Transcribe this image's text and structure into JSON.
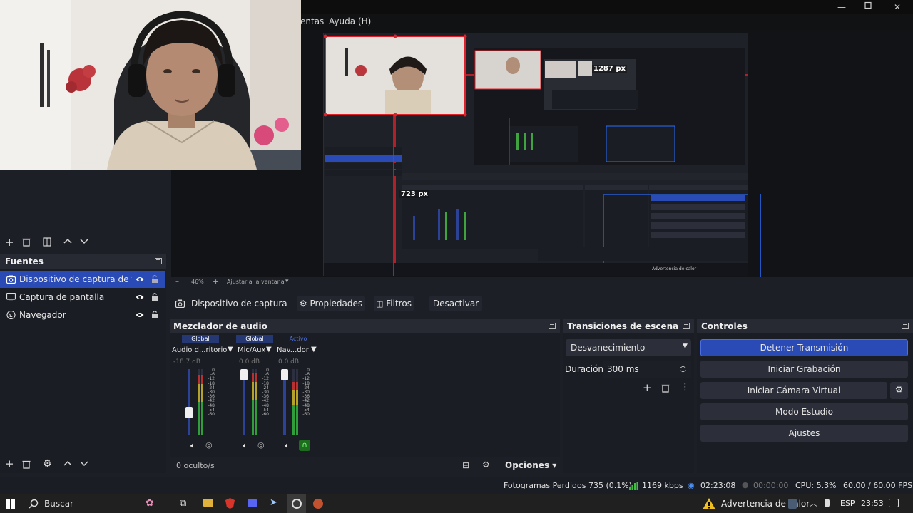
{
  "window": {
    "menu": [
      "entas",
      "Ayuda (H)"
    ],
    "controls": [
      "minimize",
      "maximize",
      "close"
    ]
  },
  "preview": {
    "overlay_width_label": "1287 px",
    "overlay_height_label": "723 px",
    "zoom_label": "46%",
    "fit_label": "Ajustar a la ventana",
    "accent_red": "#e0202a",
    "accent_blue": "#2a6dff"
  },
  "sources": {
    "title": "Fuentes",
    "items": [
      {
        "label": "Dispositivo de captura de vídeo",
        "icon": "camera-icon",
        "selected": true
      },
      {
        "label": "Captura de pantalla",
        "icon": "monitor-icon",
        "selected": false
      },
      {
        "label": "Navegador",
        "icon": "globe-icon",
        "selected": false
      }
    ]
  },
  "source_bar": {
    "current_source": "Dispositivo de captura de v",
    "properties": "Propiedades",
    "filters": "Filtros",
    "deactivate": "Desactivar"
  },
  "mixer": {
    "title": "Mezclador de audio",
    "strips": [
      {
        "tag": "Global",
        "name": "Audio d...ritorio",
        "db": "-18.7 dB",
        "fader": 0.3,
        "level": 0.9
      },
      {
        "tag": "Global",
        "name": "Mic/Aux",
        "db": "0.0 dB",
        "fader": 1.0,
        "level": 0.95
      },
      {
        "tag": "Activo",
        "name": "Nav...dor",
        "db": "0.0 dB",
        "fader": 1.0,
        "level": 0.8
      }
    ],
    "scale": [
      "0",
      "-6",
      "-12",
      "-18",
      "-24",
      "-30",
      "-36",
      "-42",
      "-48",
      "-54",
      "-60"
    ],
    "hidden_label": "0 oculto/s",
    "options_label": "Opciones"
  },
  "transitions": {
    "title": "Transiciones de escena",
    "selected": "Desvanecimiento",
    "duration_label": "Duración",
    "duration_value": "300 ms"
  },
  "controls": {
    "title": "Controles",
    "stop_stream": "Detener Transmisión",
    "start_recording": "Iniciar Grabación",
    "start_virtual_cam": "Iniciar Cámara Virtual",
    "studio_mode": "Modo Estudio",
    "settings": "Ajustes"
  },
  "status": {
    "dropped_frames": "Fotogramas Perdidos 735 (0.1%)",
    "bitrate": "1169 kbps",
    "stream_time": "02:23:08",
    "record_time": "00:00:00",
    "cpu": "CPU: 5.3%",
    "fps": "60.00 / 60.00 FPS"
  },
  "taskbar": {
    "search_placeholder": "Buscar",
    "heat_warning": "Advertencia de calor",
    "language": "ESP",
    "clock": "23:53"
  }
}
